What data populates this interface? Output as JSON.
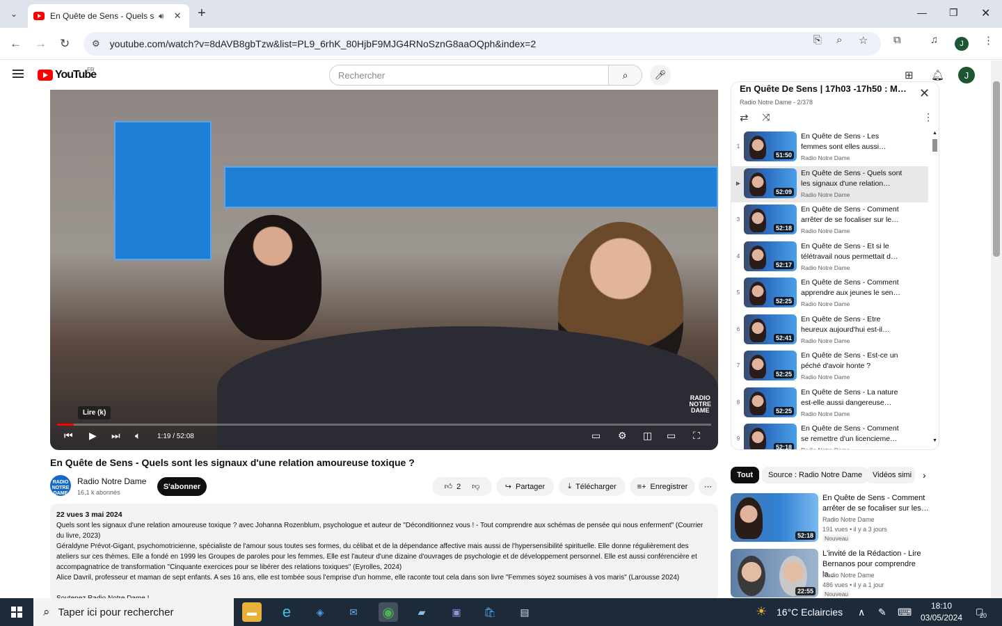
{
  "browser": {
    "tab_title": "En Quête de Sens - Quels so",
    "url": "youtube.com/watch?v=8dAVB8gbTzw&list=PL9_6rhK_80HjbF9MJG4RNoSznG8aaOQph&index=2",
    "profile_initial": "J"
  },
  "youtube": {
    "wordmark": "YouTube",
    "region": "FR",
    "search_placeholder": "Rechercher",
    "avatar_initial": "J"
  },
  "player": {
    "tooltip": "Lire (k)",
    "time": "1:19 / 52:08",
    "progress_fraction": 0.025,
    "logo_lines": [
      "RADIO",
      "NOTRE",
      "DAME"
    ]
  },
  "video": {
    "title": "En Quête de Sens - Quels sont les signaux d'une relation amoureuse toxique ?",
    "channel_avatar_text": "RADIO NOTRE DAME",
    "channel": "Radio Notre Dame",
    "subscribers": "16,1 k abonnés",
    "subscribe_label": "S'abonner",
    "likes": "2",
    "share_label": "Partager",
    "download_label": "Télécharger",
    "save_label": "Enregistrer"
  },
  "description": {
    "meta": "22 vues  3 mai 2024",
    "paragraphs": [
      "Quels sont les signaux d'une relation amoureuse toxique ? avec Johanna Rozenblum, psychologue et auteur de \"Déconditionnez vous ! - Tout comprendre aux schémas de pensée qui nous enferment\" (Courrier du livre, 2023)",
      "Géraldyne Prévot-Gigant, psychomotricienne, spécialiste de l'amour sous toutes ses formes, du célibat et de la dépendance affective mais aussi de l'hypersensibilité spirituelle. Elle donne régulièrement des ateliers sur ces thèmes. Elle a fondé en 1999 les Groupes de paroles pour les femmes. Elle est l'auteur d'une dizaine d'ouvrages de psychologie et de développement personnel. Elle est aussi conférencière et accompagnatrice de transformation \"Cinquante exercices pour se libérer des relations toxiques\" (Eyrolles, 2024)",
      "Alice Davril, professeur et maman de sept enfants. A ses 16 ans, elle est tombée sous l'emprise d'un homme, elle raconte tout cela dans son livre \"Femmes soyez soumises à vos maris\" (Larousse 2024)",
      "",
      "Soutenez Radio Notre Dame !"
    ]
  },
  "playlist": {
    "title": "En Quête De Sens | 17h03 -17h50 : M…",
    "subtitle": "Radio Notre Dame - 2/378",
    "items": [
      {
        "num": "1",
        "title": "En Quête de Sens - Les femmes sont elles aussi…",
        "channel": "Radio Notre Dame",
        "duration": "51:50"
      },
      {
        "num": "▶",
        "title": "En Quête de Sens - Quels sont les signaux d'une relation…",
        "channel": "Radio Notre Dame",
        "duration": "52:09"
      },
      {
        "num": "3",
        "title": "En Quête de Sens - Comment arrêter de se focaliser sur le…",
        "channel": "Radio Notre Dame",
        "duration": "52:18"
      },
      {
        "num": "4",
        "title": "En Quête de Sens - Et si le télétravail nous permettait d…",
        "channel": "Radio Notre Dame",
        "duration": "52:17"
      },
      {
        "num": "5",
        "title": "En Quête de Sens - Comment apprendre aux jeunes le sen…",
        "channel": "Radio Notre Dame",
        "duration": "52:25"
      },
      {
        "num": "6",
        "title": "En Quête de Sens - Etre heureux aujourd'hui est-il…",
        "channel": "Radio Notre Dame",
        "duration": "52:41"
      },
      {
        "num": "7",
        "title": "En Quête de Sens - Est-ce un péché d'avoir honte ?",
        "channel": "Radio Notre Dame",
        "duration": "52:25"
      },
      {
        "num": "8",
        "title": "En Quête de Sens - La nature est-elle aussi dangereuse…",
        "channel": "Radio Notre Dame",
        "duration": "52:25"
      },
      {
        "num": "9",
        "title": "En Quête de Sens - Comment se remettre d'un licencieme…",
        "channel": "Radio Notre Dame",
        "duration": "52:18"
      }
    ]
  },
  "chips": [
    "Tout",
    "Source : Radio Notre Dame",
    "Vidéos simi"
  ],
  "recommendations": [
    {
      "title": "En Quête de Sens - Comment arrêter de se focaliser sur les…",
      "channel": "Radio Notre Dame",
      "meta": "191 vues  • il y a 3 jours",
      "badge": "Nouveau",
      "duration": "52:18"
    },
    {
      "title": "L'invité de la Rédaction - Lire Bernanos pour comprendre la…",
      "channel": "Radio Notre Dame",
      "meta": "486 vues  • il y a 1 jour",
      "badge": "Nouveau",
      "duration": "22:55"
    }
  ],
  "taskbar": {
    "search_placeholder": "Taper ici pour rechercher",
    "weather": "16°C  Eclaircies",
    "time": "18:10",
    "date": "03/05/2024",
    "notifications": "20"
  }
}
